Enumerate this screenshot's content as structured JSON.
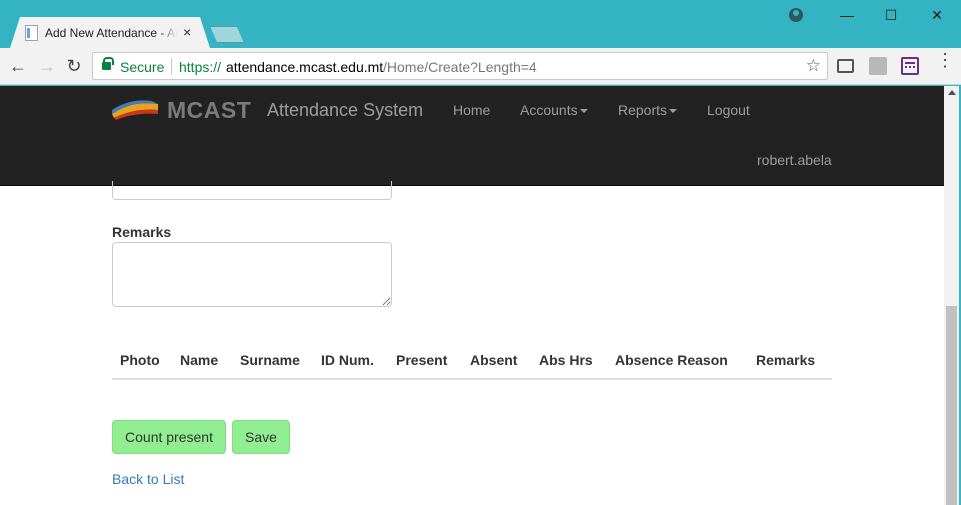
{
  "browser": {
    "tab_title": "Add New Attendance - Attendance System",
    "tab_close": "×",
    "secure_label": "Secure",
    "url_scheme": "https://",
    "url_host": "attendance.mcast.edu.mt",
    "url_path": "/Home/Create?Length=4",
    "window_controls": {
      "minimize": "—",
      "maximize": "☐",
      "close": "✕"
    },
    "nav": {
      "back": "←",
      "forward": "→",
      "reload": "↻"
    },
    "bookmark_star": "☆",
    "menu": "⋮"
  },
  "navbar": {
    "brand": "MCAST",
    "app_title": "Attendance System",
    "items": [
      {
        "label": "Home",
        "dropdown": false
      },
      {
        "label": "Accounts",
        "dropdown": true
      },
      {
        "label": "Reports",
        "dropdown": true
      },
      {
        "label": "Logout",
        "dropdown": false
      }
    ],
    "user": "robert.abela"
  },
  "form": {
    "remarks_label": "Remarks",
    "remarks_value": "",
    "table_headers": [
      "Photo",
      "Name",
      "Surname",
      "ID Num.",
      "Present",
      "Absent",
      "Abs Hrs",
      "Absence Reason",
      "Remarks"
    ],
    "count_present_label": "Count present",
    "save_label": "Save",
    "back_link": "Back to List"
  },
  "colors": {
    "chrome_accent": "#34b4c2",
    "navbar_bg": "#222222",
    "button_bg": "#90ee90",
    "link": "#337ab7",
    "secure": "#0b8043"
  }
}
